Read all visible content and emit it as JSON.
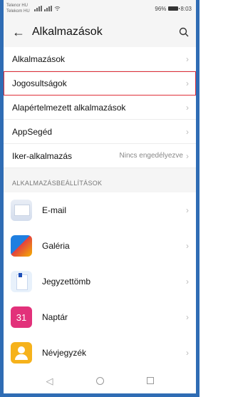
{
  "status_bar": {
    "carrier_1": "Telenor HU",
    "carrier_2": "Telekom HU",
    "battery": "96%",
    "time": "8:03"
  },
  "header": {
    "title": "Alkalmazások"
  },
  "settings": [
    {
      "label": "Alkalmazások",
      "value": ""
    },
    {
      "label": "Jogosultságok",
      "value": ""
    },
    {
      "label": "Alapértelmezett alkalmazások",
      "value": ""
    },
    {
      "label": "AppSegéd",
      "value": ""
    },
    {
      "label": "Iker-alkalmazás",
      "value": "Nincs engedélyezve"
    }
  ],
  "section": {
    "title": "ALKALMAZÁSBEÁLLÍTÁSOK"
  },
  "apps": [
    {
      "label": "E-mail",
      "icon": "mail-icon"
    },
    {
      "label": "Galéria",
      "icon": "gallery-icon"
    },
    {
      "label": "Jegyzettömb",
      "icon": "notepad-icon"
    },
    {
      "label": "Naptár",
      "icon": "calendar-icon",
      "icon_text": "31"
    },
    {
      "label": "Névjegyzék",
      "icon": "contacts-icon"
    }
  ],
  "colors": {
    "highlight": "#e0303a",
    "frame": "#2f6cb4"
  }
}
